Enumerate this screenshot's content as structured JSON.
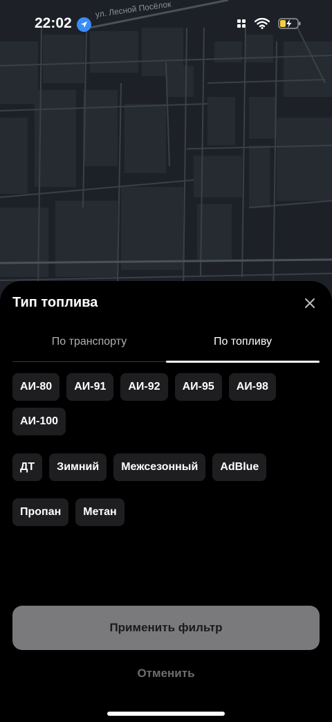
{
  "status_bar": {
    "time": "22:02",
    "location_icon": "location-arrow-icon",
    "icons": [
      "app-grid-icon",
      "wifi-icon",
      "battery-charging-icon"
    ],
    "accent": "#3a8df8"
  },
  "map": {
    "street_label": "ул. Лесной Посёлок"
  },
  "sheet": {
    "title": "Тип топлива",
    "close_icon": "close-icon",
    "tabs": [
      {
        "label": "По транспорту",
        "active": false
      },
      {
        "label": "По топливу",
        "active": true
      }
    ],
    "groups": [
      [
        "АИ-80",
        "АИ-91",
        "АИ-92",
        "АИ-95",
        "АИ-98",
        "АИ-100"
      ],
      [
        "ДТ",
        "Зимний",
        "Межсезонный",
        "AdBlue"
      ],
      [
        "Пропан",
        "Метан"
      ]
    ],
    "apply_label": "Применить фильтр",
    "cancel_label": "Отменить"
  }
}
